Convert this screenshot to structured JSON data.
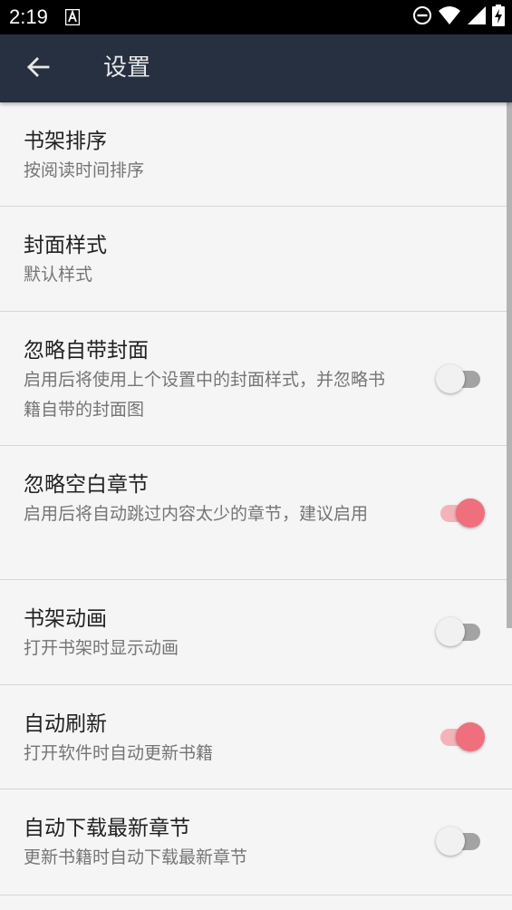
{
  "status_bar": {
    "time": "2:19",
    "icons": [
      "a-notification-icon",
      "do-not-disturb-icon",
      "wifi-icon",
      "signal-icon",
      "battery-charging-icon"
    ]
  },
  "app_bar": {
    "back_icon": "arrow-left-icon",
    "title": "设置",
    "background": "#263040"
  },
  "accent_color": "#ef6f7d",
  "settings": [
    {
      "title": "书架排序",
      "summary": "按阅读时间排序"
    },
    {
      "title": "封面样式",
      "summary": "默认样式"
    },
    {
      "title": "忽略自带封面",
      "summary": "启用后将使用上个设置中的封面样式，并忽略书籍自带的封面图",
      "enabled": false
    },
    {
      "title": "忽略空白章节",
      "summary": "启用后将自动跳过内容太少的章节，建议启用",
      "enabled": true
    },
    {
      "title": "书架动画",
      "summary": "打开书架时显示动画",
      "enabled": false
    },
    {
      "title": "自动刷新",
      "summary": "打开软件时自动更新书籍",
      "enabled": true
    },
    {
      "title": "自动下载最新章节",
      "summary": "更新书籍时自动下载最新章节",
      "enabled": false
    }
  ]
}
